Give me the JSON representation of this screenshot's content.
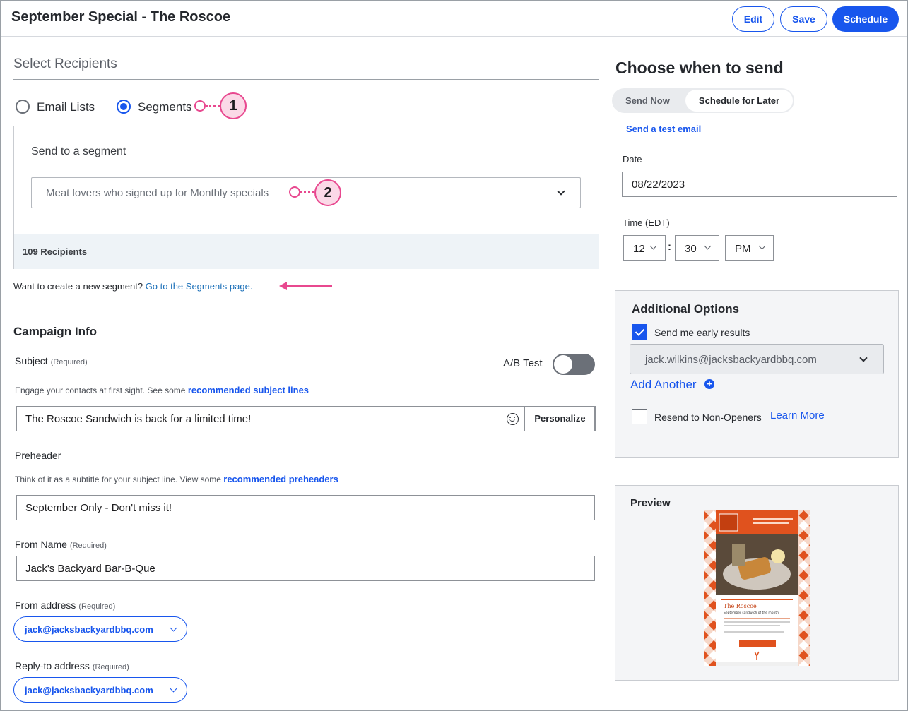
{
  "header": {
    "title": "September Special - The Roscoe",
    "edit_label": "Edit",
    "save_label": "Save",
    "schedule_label": "Schedule"
  },
  "recipients": {
    "heading": "Select Recipients",
    "radio_email_lists": "Email Lists",
    "radio_segments": "Segments",
    "selected": "Segments",
    "segment_box_title": "Send to a segment",
    "segment_selected": "Meat lovers who signed up for Monthly specials",
    "recipient_count": "109 Recipients",
    "new_segment_text": "Want to create a new segment?",
    "new_segment_link": "Go to the Segments page.",
    "callout_1": "1",
    "callout_2": "2"
  },
  "campaign": {
    "heading": "Campaign Info",
    "required": "(Required)",
    "subject_label": "Subject",
    "ab_test_label": "A/B Test",
    "ab_test_on": false,
    "subject_hint": "Engage your contacts at first sight. See some",
    "subject_hint_link": "recommended subject lines",
    "subject_value": "The Roscoe Sandwich is back for a limited time!",
    "personalize_label": "Personalize",
    "preheader_label": "Preheader",
    "preheader_hint": "Think of it as a subtitle for your subject line. View some",
    "preheader_hint_link": "recommended preheaders",
    "preheader_value": "September Only - Don't miss it!",
    "from_name_label": "From Name",
    "from_name_value": "Jack's Backyard Bar-B-Que",
    "from_address_label": "From address",
    "from_address_value": "jack@jacksbackyardbbq.com",
    "reply_to_label": "Reply-to address",
    "reply_to_value": "jack@jacksbackyardbbq.com"
  },
  "schedule": {
    "heading": "Choose when to send",
    "send_now": "Send Now",
    "schedule_later": "Schedule for Later",
    "test_email_link": "Send a test email",
    "date_label": "Date",
    "date_value": "08/22/2023",
    "time_label": "Time (EDT)",
    "hour": "12",
    "minute": "30",
    "ampm": "PM",
    "colon": ":"
  },
  "additional_options": {
    "heading": "Additional Options",
    "early_results_label": "Send me early results",
    "early_results_checked": true,
    "early_results_email": "jack.wilkins@jacksbackyardbbq.com",
    "add_another": "Add Another",
    "resend_label": "Resend to Non-Openers",
    "resend_checked": false,
    "learn_more": "Learn More"
  },
  "preview": {
    "heading": "Preview",
    "thumb_title": "The Roscoe",
    "thumb_subtitle": "September sandwich of the month"
  },
  "colors": {
    "accent": "#1856ed",
    "callout": "#e8488f",
    "preview_orange": "#e0521e"
  },
  "icons": [
    "chevron-down-icon",
    "emoji-icon",
    "plus-circle-icon",
    "checkmark-icon"
  ]
}
